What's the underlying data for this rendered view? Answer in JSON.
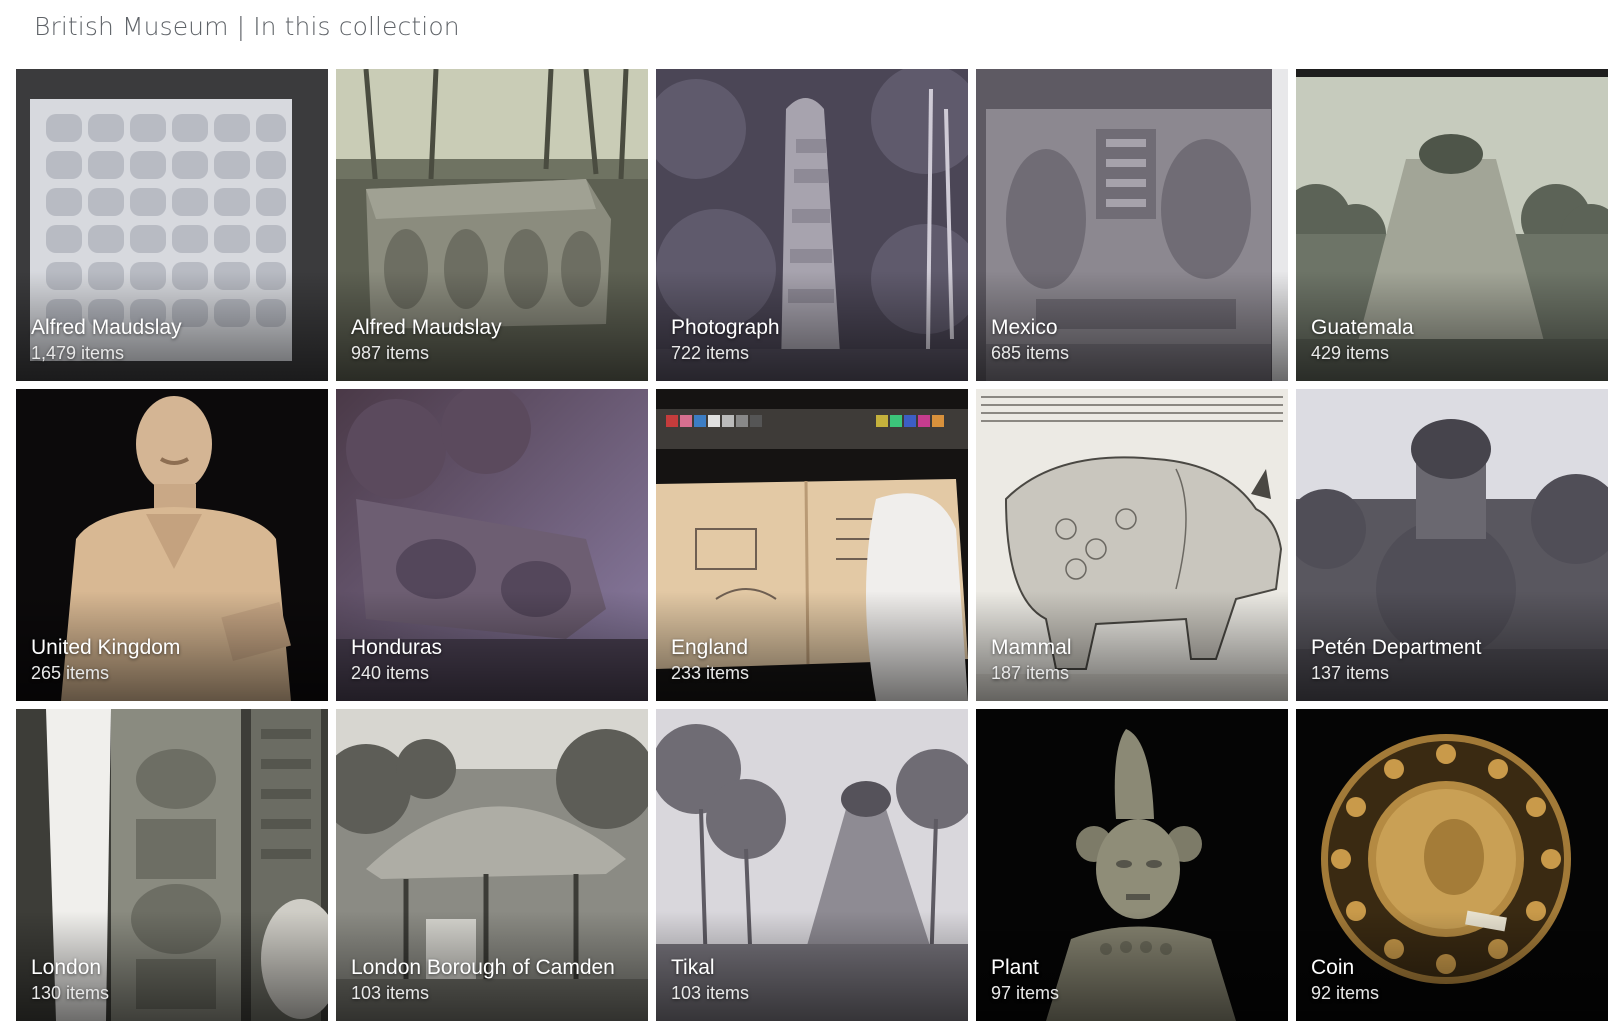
{
  "page": {
    "title": "British Museum | In this collection"
  },
  "colors": {
    "title_text": "#5f6368",
    "caption_text": "#ffffff"
  },
  "tiles": [
    {
      "name": "Alfred Maudslay",
      "count": "1,479 items",
      "image": "carved-glyph-tablet"
    },
    {
      "name": "Alfred Maudslay",
      "count": "987 items",
      "image": "carved-stone-altar-in-forest"
    },
    {
      "name": "Photograph",
      "count": "722 items",
      "image": "carved-stela-in-jungle"
    },
    {
      "name": "Mexico",
      "count": "685 items",
      "image": "carved-lintel-relief"
    },
    {
      "name": "Guatemala",
      "count": "429 items",
      "image": "overgrown-pyramid"
    },
    {
      "name": "United Kingdom",
      "count": "265 items",
      "image": "plaster-bust-of-man"
    },
    {
      "name": "Honduras",
      "count": "240 items",
      "image": "fallen-sculpture-purple-tint"
    },
    {
      "name": "England",
      "count": "233 items",
      "image": "notebook-with-sketches"
    },
    {
      "name": "Mammal",
      "count": "187 items",
      "image": "rhinoceros-woodcut"
    },
    {
      "name": "Petén Department",
      "count": "137 items",
      "image": "jungle-covered-temple"
    },
    {
      "name": "London",
      "count": "130 items",
      "image": "carved-stela-closeup"
    },
    {
      "name": "London Borough of Camden",
      "count": "103 items",
      "image": "thatched-hut-in-palms"
    },
    {
      "name": "Tikal",
      "count": "103 items",
      "image": "temple-among-trees"
    },
    {
      "name": "Plant",
      "count": "97 items",
      "image": "stone-figure-headdress"
    },
    {
      "name": "Coin",
      "count": "92 items",
      "image": "gold-coin-pendant"
    }
  ]
}
